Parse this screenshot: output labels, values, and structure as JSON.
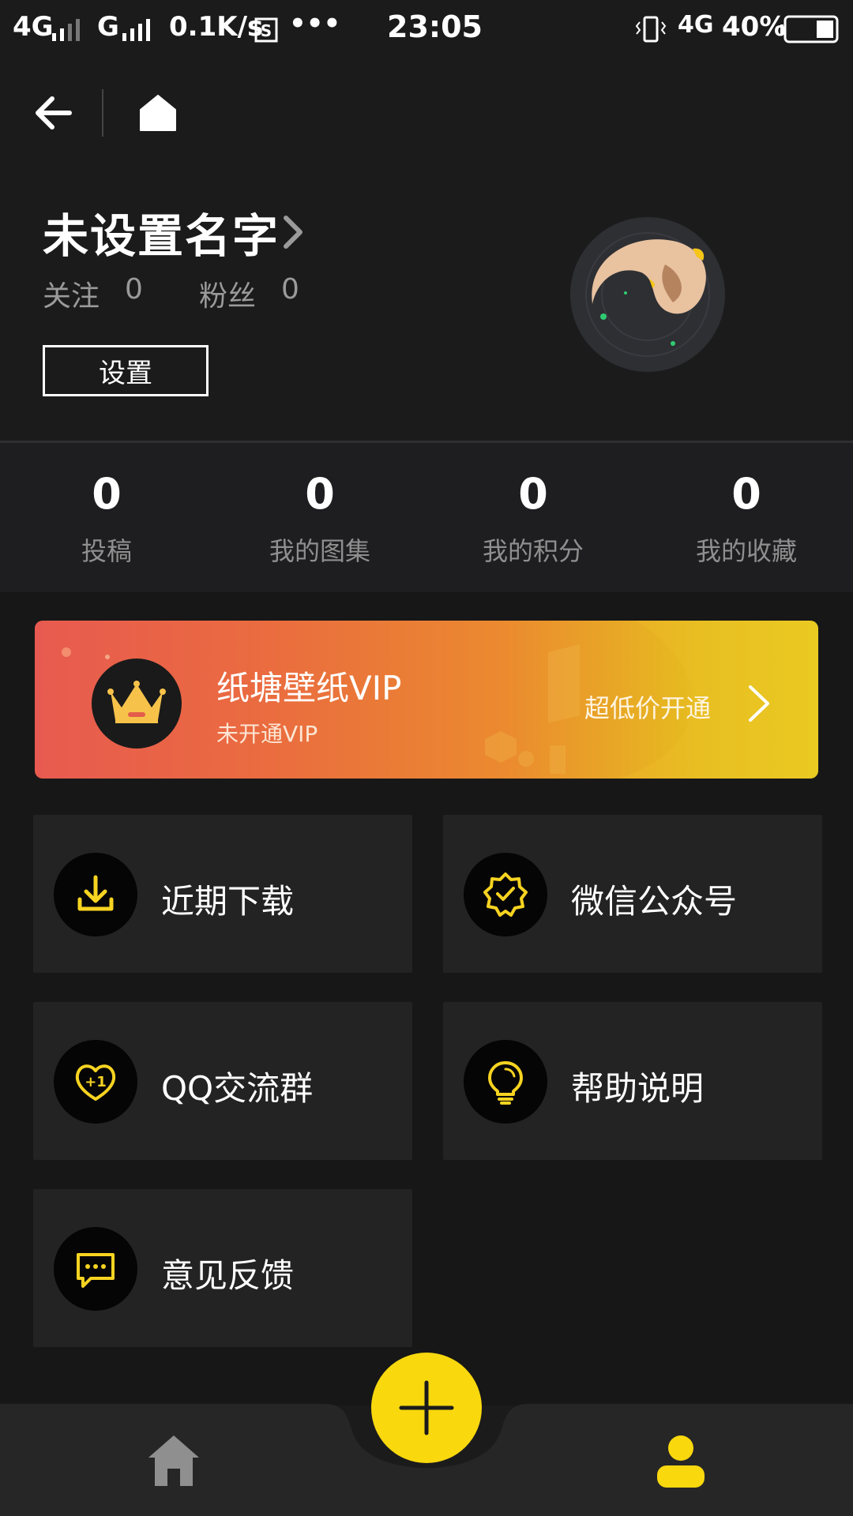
{
  "status_bar": {
    "network_left": "4G",
    "network_mid": "G",
    "speed": "0.1K/s",
    "dots": "•••",
    "time": "23:05",
    "network_right": "4G",
    "battery": "40%"
  },
  "profile": {
    "name": "未设置名字",
    "following_label": "关注",
    "following_count": "0",
    "fans_label": "粉丝",
    "fans_count": "0",
    "settings_label": "设置"
  },
  "stats": [
    {
      "value": "0",
      "label": "投稿"
    },
    {
      "value": "0",
      "label": "我的图集"
    },
    {
      "value": "0",
      "label": "我的积分"
    },
    {
      "value": "0",
      "label": "我的收藏"
    }
  ],
  "vip": {
    "title": "纸塘壁纸VIP",
    "status": "未开通VIP",
    "cta": "超低价开通"
  },
  "menu": [
    {
      "label": "近期下载",
      "icon": "download-icon"
    },
    {
      "label": "微信公众号",
      "icon": "badge-check-icon"
    },
    {
      "label": "QQ交流群",
      "icon": "heart-plus-one-icon"
    },
    {
      "label": "帮助说明",
      "icon": "lightbulb-icon"
    },
    {
      "label": "意见反馈",
      "icon": "chat-bubble-icon"
    }
  ],
  "bottom_nav": {
    "items": [
      {
        "icon": "home-icon",
        "active": false
      },
      {
        "icon": "plus-icon",
        "active": false
      },
      {
        "icon": "profile-icon",
        "active": true
      }
    ]
  },
  "colors": {
    "accent": "#f9d80e",
    "background": "#1b1b1c",
    "tile": "#232323",
    "muted_text": "#9a9a9a"
  }
}
